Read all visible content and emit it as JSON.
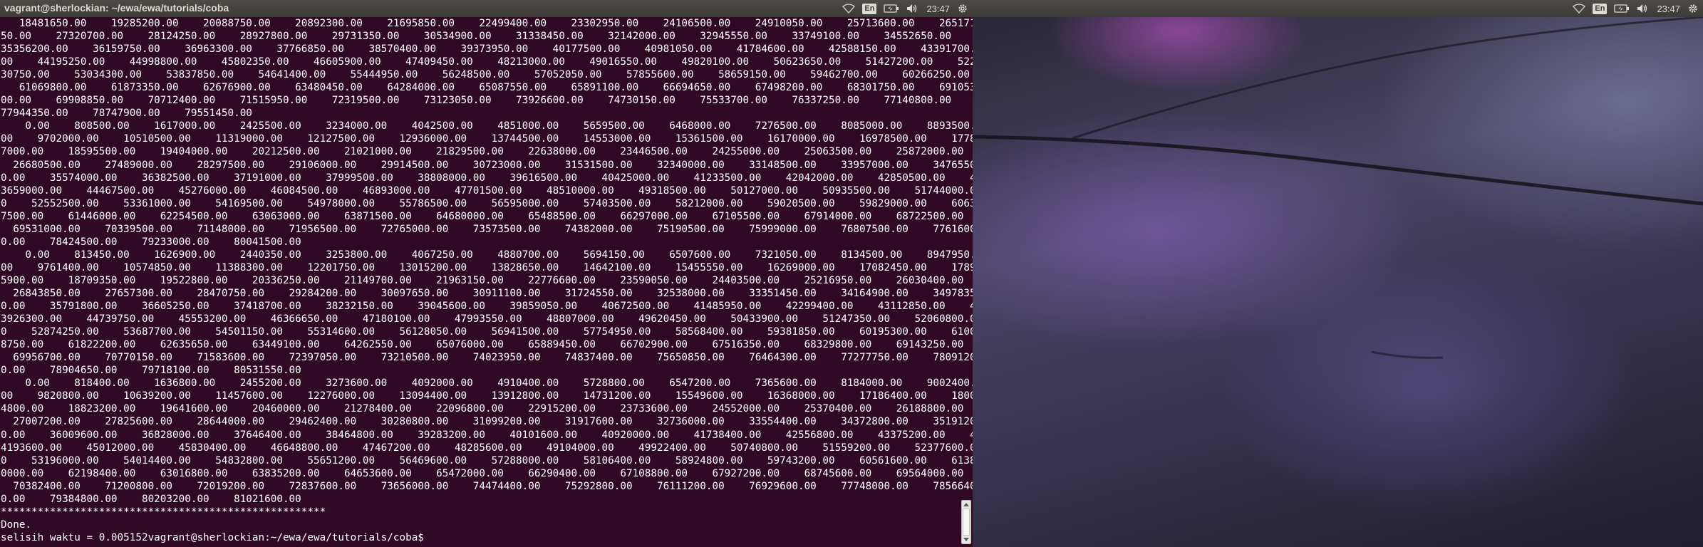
{
  "left_panel": {
    "window_title": "vagrant@sherlockian: ~/ewa/ewa/tutorials/coba",
    "indicators": {
      "wifi_icon": "wifi-icon",
      "keyboard_layout": "En",
      "battery_icon": "battery-icon",
      "volume_icon": "volume-icon",
      "clock": "23:47",
      "settings_icon": "gear-icon"
    }
  },
  "right_panel": {
    "indicators": {
      "wifi_icon": "wifi-icon",
      "keyboard_layout": "En",
      "battery_icon": "battery-icon",
      "volume_icon": "volume-icon",
      "clock": "23:47",
      "settings_icon": "gear-icon"
    }
  },
  "terminal": {
    "background": "#300a24",
    "output": "   18481650.00    19285200.00    20088750.00    20892300.00    21695850.00    22499400.00    23302950.00    24106500.00    24910050.00    25713600.00    26517150.00    27320700.00    28124250.00    28927800.00    29731350.00    30534900.00    31338450.00    32142000.00    32945550.00    33749100.00    34552650.00    35356200.00    36159750.00    36963300.00    37766850.00    38570400.00    39373950.00    40177500.00    40981050.00    41784600.00    42588150.00    43391700.00    44195250.00    44998800.00    45802350.00    46605900.00    47409450.00    48213000.00    49016550.00    49820100.00    50623650.00    51427200.00    52230750.00    53034300.00    53837850.00    54641400.00    55444950.00    56248500.00    57052050.00    57855600.00    58659150.00    59462700.00    60266250.00    61069800.00    61873350.00    62676900.00    63480450.00    64284000.00    65087550.00    65891100.00    66694650.00    67498200.00    68301750.00    69105300.00    69908850.00    70712400.00    71515950.00    72319500.00    73123050.00    73926600.00    74730150.00    75533700.00    76337250.00    77140800.00    77944350.00    78747900.00    79551450.00\n    0.00    808500.00    1617000.00    2425500.00    3234000.00    4042500.00    4851000.00    5659500.00    6468000.00    7276500.00    8085000.00    8893500.00    9702000.00    10510500.00    11319000.00    12127500.00    12936000.00    13744500.00    14553000.00    15361500.00    16170000.00    16978500.00    17787000.00    18595500.00    19404000.00    20212500.00    21021000.00    21829500.00    22638000.00    23446500.00    24255000.00    25063500.00    25872000.00    26680500.00    27489000.00    28297500.00    29106000.00    29914500.00    30723000.00    31531500.00    32340000.00    33148500.00    33957000.00    34765500.00    35574000.00    36382500.00    37191000.00    37999500.00    38808000.00    39616500.00    40425000.00    41233500.00    42042000.00    42850500.00    43659000.00    44467500.00    45276000.00    46084500.00    46893000.00    47701500.00    48510000.00    49318500.00    50127000.00    50935500.00    51744000.00    52552500.00    53361000.00    54169500.00    54978000.00    55786500.00    56595000.00    57403500.00    58212000.00    59020500.00    59829000.00    60637500.00    61446000.00    62254500.00    63063000.00    63871500.00    64680000.00    65488500.00    66297000.00    67105500.00    67914000.00    68722500.00    69531000.00    70339500.00    71148000.00    71956500.00    72765000.00    73573500.00    74382000.00    75190500.00    75999000.00    76807500.00    77616000.00    78424500.00    79233000.00    80041500.00\n    0.00    813450.00    1626900.00    2440350.00    3253800.00    4067250.00    4880700.00    5694150.00    6507600.00    7321050.00    8134500.00    8947950.00    9761400.00    10574850.00    11388300.00    12201750.00    13015200.00    13828650.00    14642100.00    15455550.00    16269000.00    17082450.00    17895900.00    18709350.00    19522800.00    20336250.00    21149700.00    21963150.00    22776600.00    23590050.00    24403500.00    25216950.00    26030400.00    26843850.00    27657300.00    28470750.00    29284200.00    30097650.00    30911100.00    31724550.00    32538000.00    33351450.00    34164900.00    34978350.00    35791800.00    36605250.00    37418700.00    38232150.00    39045600.00    39859050.00    40672500.00    41485950.00    42299400.00    43112850.00    43926300.00    44739750.00    45553200.00    46366650.00    47180100.00    47993550.00    48807000.00    49620450.00    50433900.00    51247350.00    52060800.00    52874250.00    53687700.00    54501150.00    55314600.00    56128050.00    56941500.00    57754950.00    58568400.00    59381850.00    60195300.00    61008750.00    61822200.00    62635650.00    63449100.00    64262550.00    65076000.00    65889450.00    66702900.00    67516350.00    68329800.00    69143250.00    69956700.00    70770150.00    71583600.00    72397050.00    73210500.00    74023950.00    74837400.00    75650850.00    76464300.00    77277750.00    78091200.00    78904650.00    79718100.00    80531550.00\n    0.00    818400.00    1636800.00    2455200.00    3273600.00    4092000.00    4910400.00    5728800.00    6547200.00    7365600.00    8184000.00    9002400.00    9820800.00    10639200.00    11457600.00    12276000.00    13094400.00    13912800.00    14731200.00    15549600.00    16368000.00    17186400.00    18004800.00    18823200.00    19641600.00    20460000.00    21278400.00    22096800.00    22915200.00    23733600.00    24552000.00    25370400.00    26188800.00    27007200.00    27825600.00    28644000.00    29462400.00    30280800.00    31099200.00    31917600.00    32736000.00    33554400.00    34372800.00    35191200.00    36009600.00    36828000.00    37646400.00    38464800.00    39283200.00    40101600.00    40920000.00    41738400.00    42556800.00    43375200.00    44193600.00    45012000.00    45830400.00    46648800.00    47467200.00    48285600.00    49104000.00    49922400.00    50740800.00    51559200.00    52377600.00    53196000.00    54014400.00    54832800.00    55651200.00    56469600.00    57288000.00    58106400.00    58924800.00    59743200.00    60561600.00    61380000.00    62198400.00    63016800.00    63835200.00    64653600.00    65472000.00    66290400.00    67108800.00    67927200.00    68745600.00    69564000.00    70382400.00    71200800.00    72019200.00    72837600.00    73656000.00    74474400.00    75292800.00    76111200.00    76929600.00    77748000.00    78566400.00    79384800.00    80203200.00    81021600.00\n*****************************************************\nDone.\nselisih waktu = 0.005152vagrant@sherlockian:~/ewa/ewa/tutorials/coba$ "
  }
}
